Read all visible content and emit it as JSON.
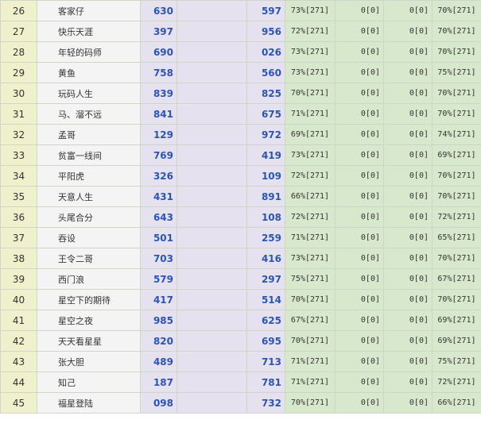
{
  "rows": [
    {
      "rank": "26",
      "name": "客家仔",
      "n1": "630",
      "n2": "597",
      "p1": "73%[271]",
      "z1": "0[0]",
      "z2": "0[0]",
      "p2": "70%[271]"
    },
    {
      "rank": "27",
      "name": "快乐天涯",
      "n1": "397",
      "n2": "956",
      "p1": "72%[271]",
      "z1": "0[0]",
      "z2": "0[0]",
      "p2": "70%[271]"
    },
    {
      "rank": "28",
      "name": "年轻的码师",
      "n1": "690",
      "n2": "026",
      "p1": "73%[271]",
      "z1": "0[0]",
      "z2": "0[0]",
      "p2": "70%[271]"
    },
    {
      "rank": "29",
      "name": "黄鱼",
      "n1": "758",
      "n2": "560",
      "p1": "73%[271]",
      "z1": "0[0]",
      "z2": "0[0]",
      "p2": "75%[271]"
    },
    {
      "rank": "30",
      "name": "玩码人生",
      "n1": "839",
      "n2": "825",
      "p1": "70%[271]",
      "z1": "0[0]",
      "z2": "0[0]",
      "p2": "70%[271]"
    },
    {
      "rank": "31",
      "name": "马、溜不远",
      "n1": "841",
      "n2": "675",
      "p1": "71%[271]",
      "z1": "0[0]",
      "z2": "0[0]",
      "p2": "70%[271]"
    },
    {
      "rank": "32",
      "name": "孟哥",
      "n1": "129",
      "n2": "972",
      "p1": "69%[271]",
      "z1": "0[0]",
      "z2": "0[0]",
      "p2": "74%[271]"
    },
    {
      "rank": "33",
      "name": "贫富一线间",
      "n1": "769",
      "n2": "419",
      "p1": "73%[271]",
      "z1": "0[0]",
      "z2": "0[0]",
      "p2": "69%[271]"
    },
    {
      "rank": "34",
      "name": "平阳虎",
      "n1": "326",
      "n2": "109",
      "p1": "72%[271]",
      "z1": "0[0]",
      "z2": "0[0]",
      "p2": "70%[271]"
    },
    {
      "rank": "35",
      "name": "天意人生",
      "n1": "431",
      "n2": "891",
      "p1": "66%[271]",
      "z1": "0[0]",
      "z2": "0[0]",
      "p2": "70%[271]"
    },
    {
      "rank": "36",
      "name": "头尾合分",
      "n1": "643",
      "n2": "108",
      "p1": "72%[271]",
      "z1": "0[0]",
      "z2": "0[0]",
      "p2": "72%[271]"
    },
    {
      "rank": "37",
      "name": "吞设",
      "n1": "501",
      "n2": "259",
      "p1": "71%[271]",
      "z1": "0[0]",
      "z2": "0[0]",
      "p2": "65%[271]"
    },
    {
      "rank": "38",
      "name": "王令二哥",
      "n1": "703",
      "n2": "416",
      "p1": "73%[271]",
      "z1": "0[0]",
      "z2": "0[0]",
      "p2": "70%[271]"
    },
    {
      "rank": "39",
      "name": "西门浪",
      "n1": "579",
      "n2": "297",
      "p1": "75%[271]",
      "z1": "0[0]",
      "z2": "0[0]",
      "p2": "67%[271]"
    },
    {
      "rank": "40",
      "name": "星空下的期待",
      "n1": "417",
      "n2": "514",
      "p1": "70%[271]",
      "z1": "0[0]",
      "z2": "0[0]",
      "p2": "70%[271]"
    },
    {
      "rank": "41",
      "name": "星空之夜",
      "n1": "985",
      "n2": "625",
      "p1": "67%[271]",
      "z1": "0[0]",
      "z2": "0[0]",
      "p2": "69%[271]"
    },
    {
      "rank": "42",
      "name": "天天看星星",
      "n1": "820",
      "n2": "695",
      "p1": "70%[271]",
      "z1": "0[0]",
      "z2": "0[0]",
      "p2": "69%[271]"
    },
    {
      "rank": "43",
      "name": "张大胆",
      "n1": "489",
      "n2": "713",
      "p1": "71%[271]",
      "z1": "0[0]",
      "z2": "0[0]",
      "p2": "75%[271]"
    },
    {
      "rank": "44",
      "name": "知己",
      "n1": "187",
      "n2": "781",
      "p1": "71%[271]",
      "z1": "0[0]",
      "z2": "0[0]",
      "p2": "72%[271]"
    },
    {
      "rank": "45",
      "name": "福星登陆",
      "n1": "098",
      "n2": "732",
      "p1": "70%[271]",
      "z1": "0[0]",
      "z2": "0[0]",
      "p2": "66%[271]"
    }
  ]
}
